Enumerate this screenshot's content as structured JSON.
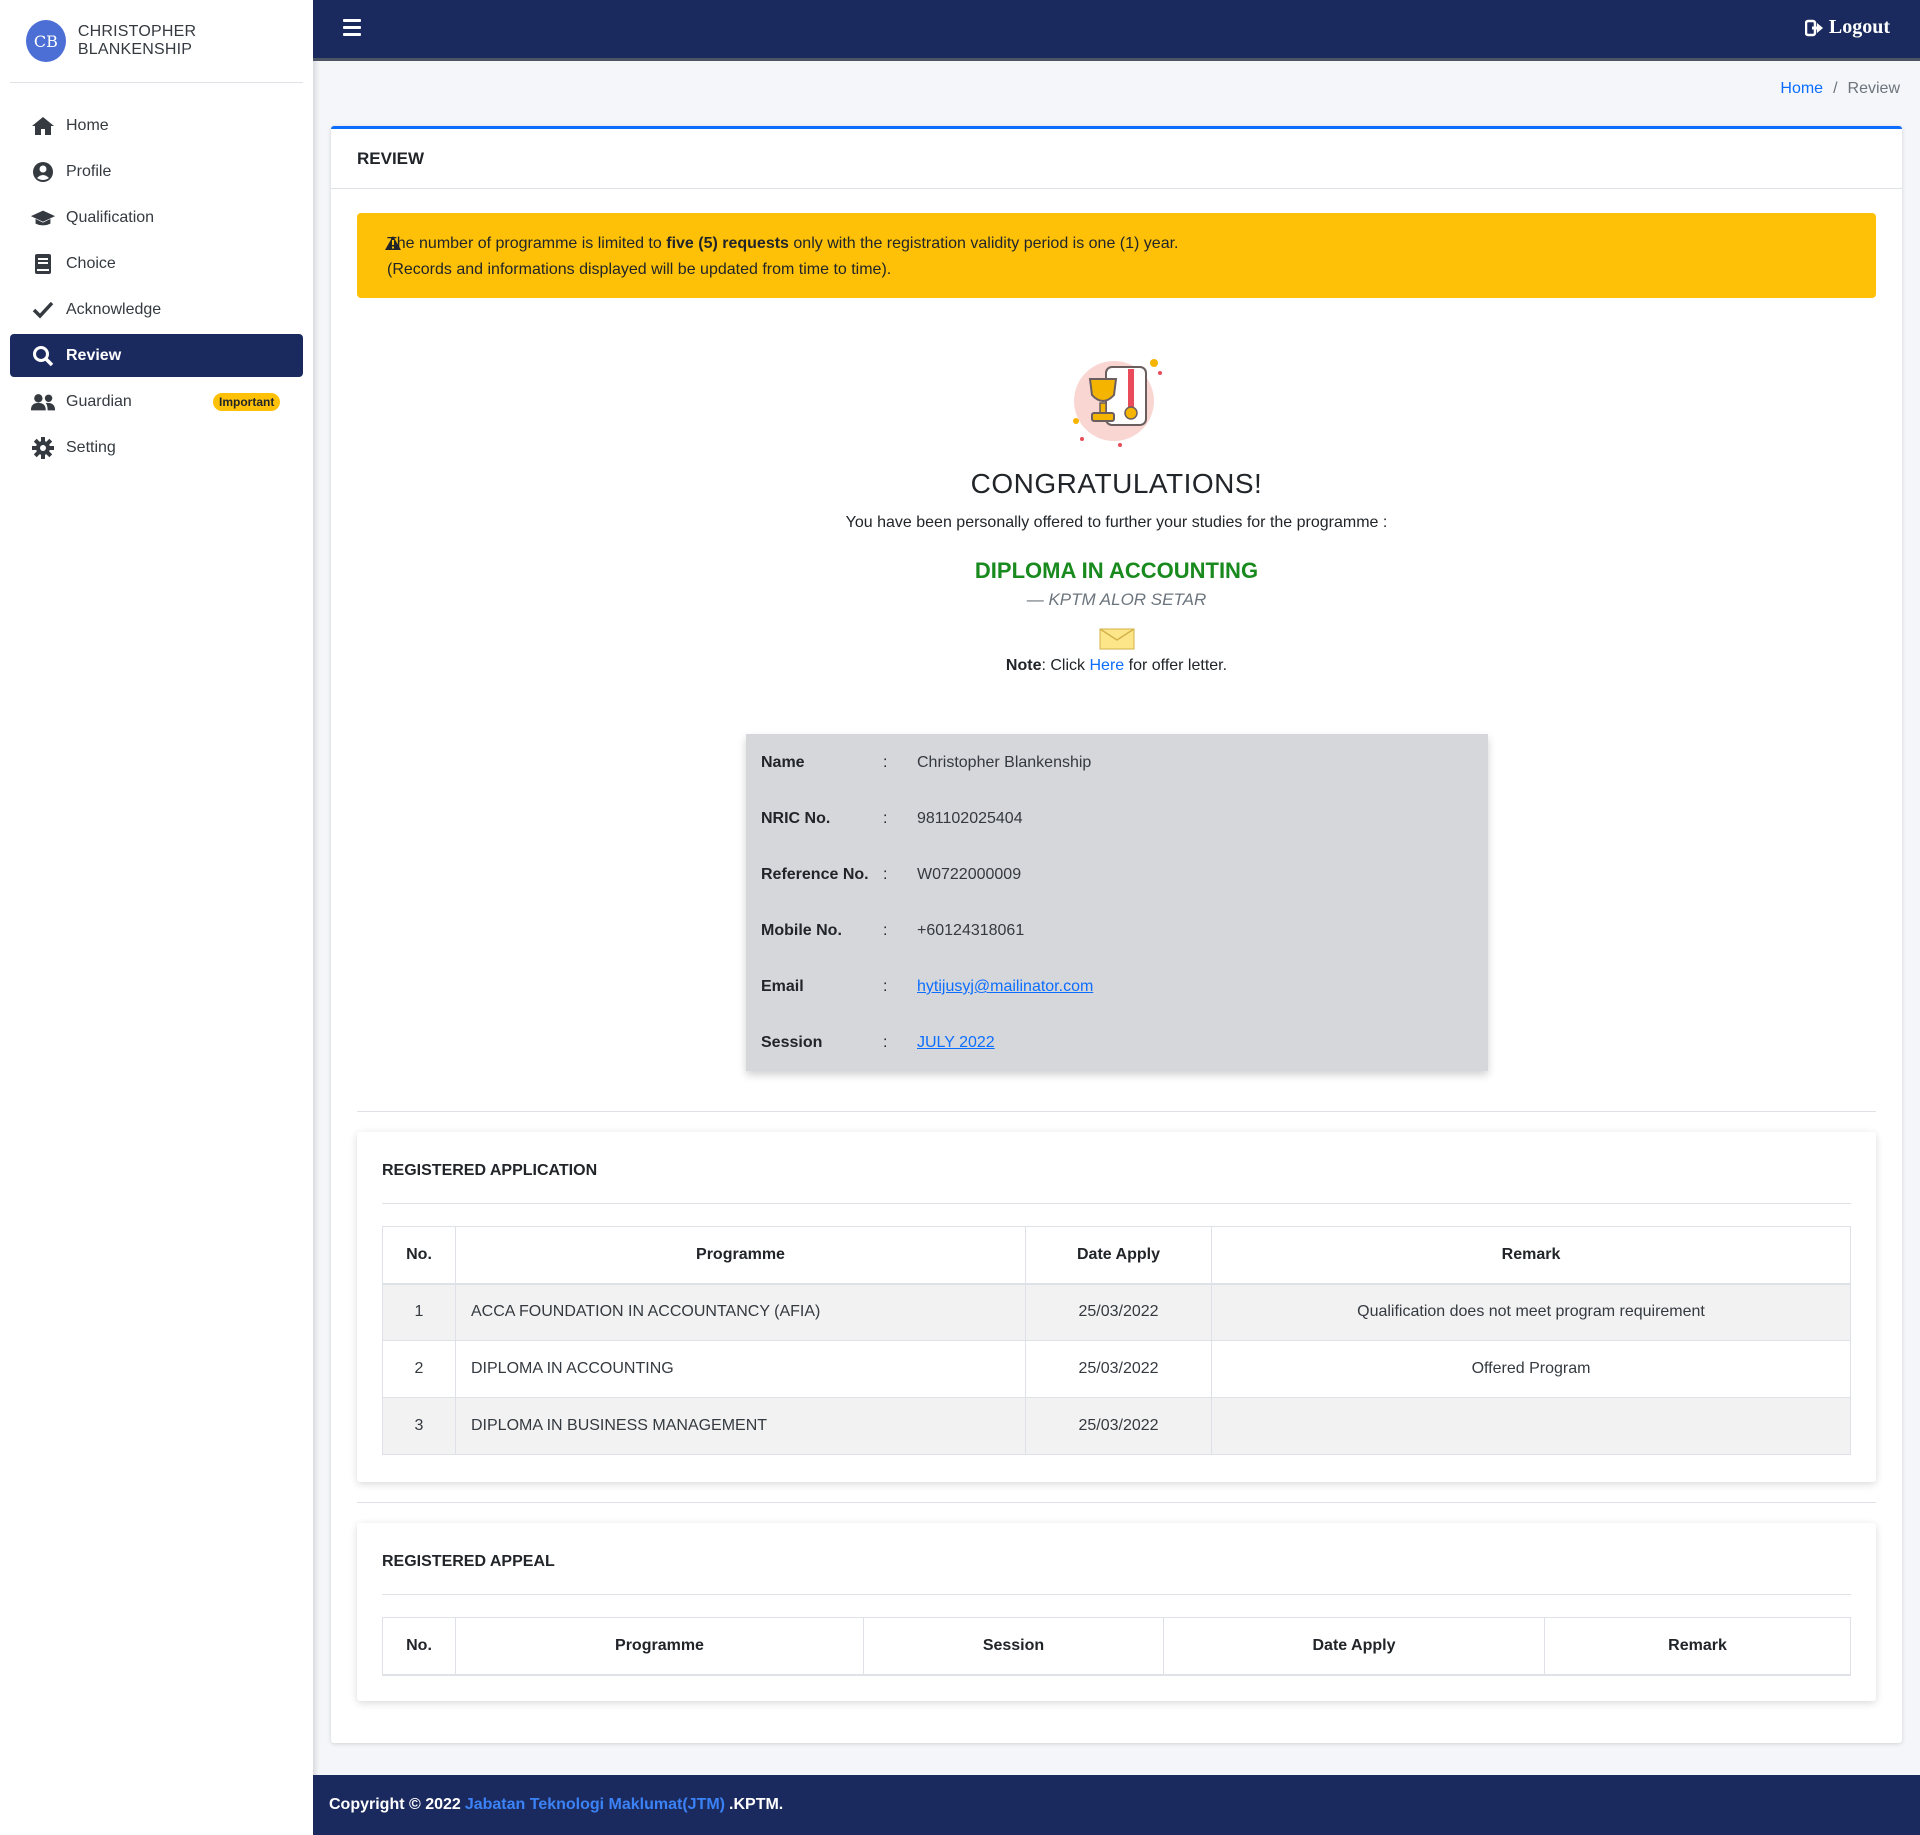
{
  "user": {
    "initials": "CB",
    "name": "CHRISTOPHER BLANKENSHIP"
  },
  "sidebar": {
    "items": [
      {
        "label": "Home",
        "icon": "home-icon"
      },
      {
        "label": "Profile",
        "icon": "user-circle-icon"
      },
      {
        "label": "Qualification",
        "icon": "graduation-cap-icon"
      },
      {
        "label": "Choice",
        "icon": "book-icon"
      },
      {
        "label": "Acknowledge",
        "icon": "check-icon"
      },
      {
        "label": "Review",
        "icon": "search-icon",
        "active": true
      },
      {
        "label": "Guardian",
        "icon": "users-icon",
        "badge": "Important"
      },
      {
        "label": "Setting",
        "icon": "gear-icon"
      }
    ]
  },
  "topbar": {
    "logout_label": "Logout"
  },
  "breadcrumb": {
    "home": "Home",
    "separator": "/",
    "current": "Review"
  },
  "card": {
    "title": "REVIEW"
  },
  "alert": {
    "text_before": "The number of programme is limited to",
    "text_bold": "five (5) requests",
    "text_after": "only with the registration validity period is one (1) year.",
    "line2": "(Records and informations displayed will be updated from time to time)."
  },
  "offer": {
    "heading": "CONGRATULATIONS!",
    "message": "You have been personally offered to further your studies for the programme :",
    "programme": "DIPLOMA IN ACCOUNTING",
    "campus": "— KPTM ALOR SETAR",
    "note_label": "Note",
    "note_click": ": Click",
    "note_link": "Here",
    "note_rest": "for offer letter."
  },
  "applicant": {
    "rows": [
      {
        "label": "Name",
        "value": "Christopher Blankenship"
      },
      {
        "label": "NRIC No.",
        "value": "981102025404"
      },
      {
        "label": "Reference No.",
        "value": "W0722000009"
      },
      {
        "label": "Mobile No.",
        "value": "+60124318061"
      },
      {
        "label": "Email",
        "value": "hytijusyj@mailinator.com"
      },
      {
        "label": "Session",
        "value": "JULY 2022"
      }
    ],
    "colon": ":"
  },
  "registered_application": {
    "title": "REGISTERED APPLICATION",
    "columns": [
      "No.",
      "Programme",
      "Date Apply",
      "Remark"
    ],
    "rows": [
      {
        "no": "1",
        "programme": "ACCA FOUNDATION IN ACCOUNTANCY (AFIA)",
        "date": "25/03/2022",
        "remark": "Qualification does not meet program requirement"
      },
      {
        "no": "2",
        "programme": "DIPLOMA IN ACCOUNTING",
        "date": "25/03/2022",
        "remark": "Offered Program"
      },
      {
        "no": "3",
        "programme": "DIPLOMA IN BUSINESS MANAGEMENT",
        "date": "25/03/2022",
        "remark": ""
      }
    ]
  },
  "registered_appeal": {
    "title": "REGISTERED APPEAL",
    "columns": [
      "No.",
      "Programme",
      "Session",
      "Date Apply",
      "Remark"
    ]
  },
  "footer": {
    "prefix": "Copyright © 2022",
    "org": "Jabatan Teknologi Maklumat(JTM)",
    "suffix": ".KPTM."
  },
  "colors": {
    "navy": "#1b2a5e",
    "warning": "#ffc107",
    "success": "#198a1e",
    "link": "#0d6efd"
  }
}
